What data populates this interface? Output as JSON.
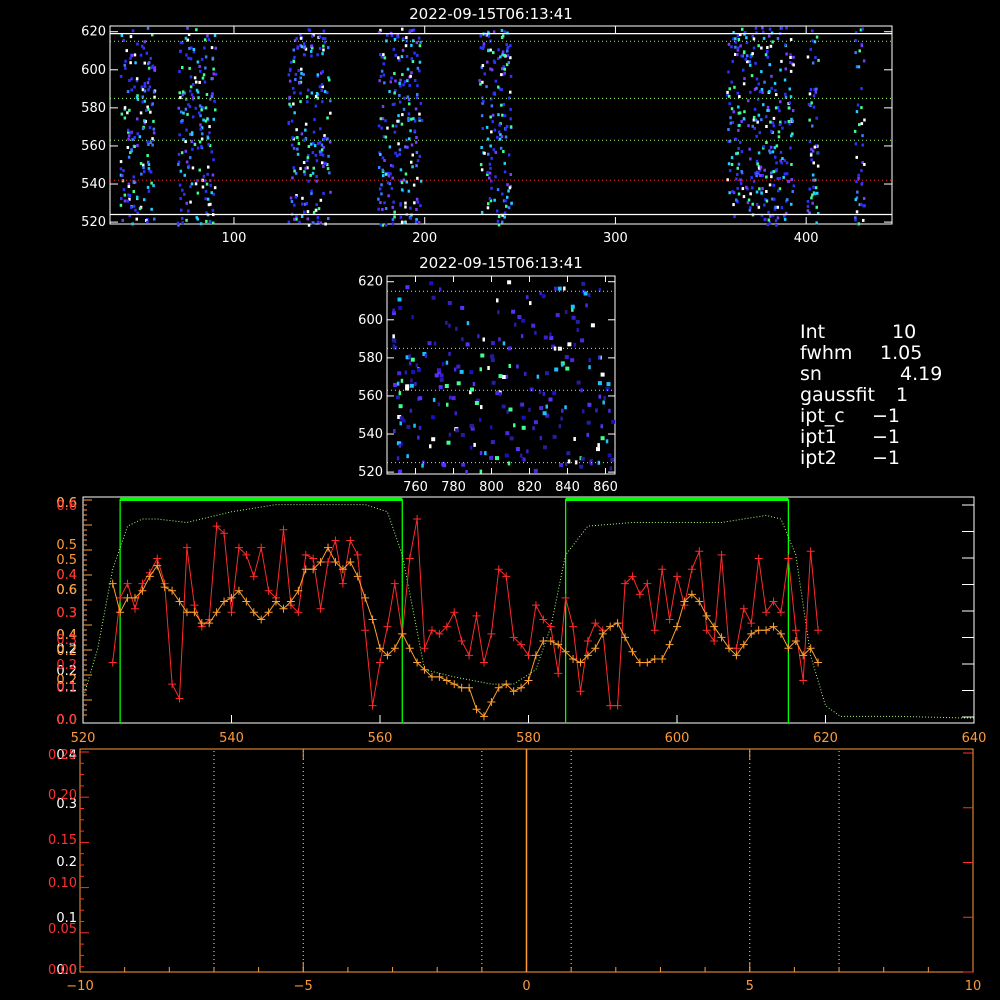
{
  "colors": {
    "background": "#000000",
    "axes": "#ffffff",
    "red_series": "#ff2a2a",
    "orange_series": "#ffa030",
    "green_dotted": "#a0ff70",
    "green_band": "#00ff00",
    "dark_orange_axis": "#ff9a3a",
    "blue_pixels": "#3030ff",
    "cyan_pixels": "#20d0ff"
  },
  "info_panel": [
    {
      "key": "Int",
      "value": "10"
    },
    {
      "key": "fwhm",
      "value": "1.05"
    },
    {
      "key": "sn",
      "value": "4.19"
    },
    {
      "key": "gaussfit",
      "value": "1"
    },
    {
      "key": "ipt_c",
      "value": "−1"
    },
    {
      "key": "ipt1",
      "value": "−1"
    },
    {
      "key": "ipt2",
      "value": "−1"
    }
  ],
  "chart_data": [
    {
      "type": "heatmap",
      "title": "2022-09-15T06:13:41",
      "xlim": [
        35,
        445
      ],
      "ylim": [
        519,
        623
      ],
      "x_ticks": [
        100,
        200,
        300,
        400
      ],
      "y_ticks": [
        520,
        540,
        560,
        580,
        600,
        620
      ],
      "hlines_white": [
        619,
        524
      ],
      "hlines_green_dotted": [
        615,
        585,
        563
      ],
      "hlines_red_dotted": [
        542
      ],
      "pixel_columns": [
        [
          40,
          58
        ],
        [
          70,
          90
        ],
        [
          128,
          150
        ],
        [
          175,
          198
        ],
        [
          228,
          245
        ],
        [
          358,
          393
        ],
        [
          400,
          406
        ],
        [
          425,
          430
        ]
      ]
    },
    {
      "type": "heatmap",
      "title": "2022-09-15T06:13:41",
      "xlim": [
        745,
        865
      ],
      "ylim": [
        519,
        623
      ],
      "x_ticks": [
        760,
        780,
        800,
        820,
        840,
        860
      ],
      "y_ticks": [
        520,
        540,
        560,
        580,
        600,
        620
      ],
      "hlines_green_dotted": [
        615,
        585,
        563,
        525
      ]
    },
    {
      "type": "line",
      "xlim": [
        520,
        640
      ],
      "ylim": [
        0,
        0.61
      ],
      "x_ticks": [
        520,
        540,
        560,
        580,
        600,
        620,
        640
      ],
      "left_tick_labels_white": [
        "0.0",
        "0.1",
        "0.2",
        "0.2",
        "0.4",
        "0.6",
        "0.6"
      ],
      "left_tick_labels_orange": [
        "0.0",
        "0.2",
        "0.2",
        "0.4",
        "0.6",
        "0.3",
        "0.4",
        "0.5",
        "0.5",
        "0.6"
      ],
      "left_tick_labels_red": [
        "0.0",
        "0.1",
        "0.2",
        "0.3",
        "0.3",
        "0.4",
        "0.6"
      ],
      "green_bands": [
        [
          525,
          563
        ],
        [
          585,
          615
        ]
      ],
      "series": [
        {
          "x": [
            524,
            525,
            526,
            527,
            528,
            529,
            530,
            531,
            532,
            533,
            534,
            535,
            536,
            537,
            538,
            539,
            540,
            541,
            542,
            543,
            544,
            545,
            546,
            547,
            548,
            549,
            550,
            551,
            552,
            553,
            554,
            555,
            556,
            557,
            558,
            559,
            560,
            561,
            562,
            563,
            564,
            565,
            566,
            567,
            568,
            569,
            570,
            571,
            572,
            573,
            574,
            575,
            576,
            577,
            578,
            579,
            580,
            581,
            582,
            583,
            584,
            585,
            586,
            587,
            588,
            589,
            590,
            591,
            592,
            593,
            594,
            595,
            596,
            597,
            598,
            599,
            600,
            601,
            602,
            603,
            604,
            605,
            606,
            607,
            608,
            609,
            610,
            611,
            612,
            613,
            614,
            615,
            616,
            617,
            618,
            619
          ],
          "values": [
            0.16,
            0.34,
            0.38,
            0.31,
            0.38,
            0.41,
            0.45,
            0.38,
            0.1,
            0.06,
            0.48,
            0.32,
            0.26,
            0.28,
            0.54,
            0.52,
            0.3,
            0.48,
            0.46,
            0.4,
            0.48,
            0.36,
            0.34,
            0.53,
            0.32,
            0.3,
            0.46,
            0.45,
            0.31,
            0.44,
            0.5,
            0.38,
            0.5,
            0.46,
            0.25,
            0.04,
            0.16,
            0.26,
            0.38,
            0.24,
            0.45,
            0.56,
            0.2,
            0.25,
            0.24,
            0.26,
            0.3,
            0.22,
            0.18,
            0.29,
            0.16,
            0.24,
            0.42,
            0.4,
            0.23,
            0.21,
            0.18,
            0.32,
            0.28,
            0.26,
            0.13,
            0.34,
            0.26,
            0.08,
            0.22,
            0.27,
            0.25,
            0.04,
            0.04,
            0.38,
            0.4,
            0.35,
            0.38,
            0.25,
            0.42,
            0.28,
            0.4,
            0.32,
            0.42,
            0.47,
            0.25,
            0.22,
            0.46,
            0.2,
            0.2,
            0.31,
            0.27,
            0.45,
            0.3,
            0.33,
            0.3,
            0.45,
            0.25,
            0.11,
            0.47,
            0.25
          ]
        },
        {
          "x": [
            524,
            525,
            526,
            527,
            528,
            529,
            530,
            531,
            532,
            533,
            534,
            535,
            536,
            537,
            538,
            539,
            540,
            541,
            542,
            543,
            544,
            545,
            546,
            547,
            548,
            549,
            550,
            551,
            552,
            553,
            554,
            555,
            556,
            557,
            558,
            559,
            560,
            561,
            562,
            563,
            564,
            565,
            566,
            567,
            568,
            569,
            570,
            571,
            572,
            573,
            574,
            575,
            576,
            577,
            578,
            579,
            580,
            581,
            582,
            583,
            584,
            585,
            586,
            587,
            588,
            589,
            590,
            591,
            592,
            593,
            594,
            595,
            596,
            597,
            598,
            599,
            600,
            601,
            602,
            603,
            604,
            605,
            606,
            607,
            608,
            609,
            610,
            611,
            612,
            613,
            614,
            615,
            616,
            617,
            618,
            619
          ],
          "values": [
            0.38,
            0.3,
            0.34,
            0.34,
            0.36,
            0.4,
            0.43,
            0.37,
            0.36,
            0.33,
            0.3,
            0.3,
            0.27,
            0.27,
            0.3,
            0.33,
            0.34,
            0.36,
            0.33,
            0.3,
            0.28,
            0.3,
            0.33,
            0.31,
            0.33,
            0.36,
            0.42,
            0.42,
            0.44,
            0.48,
            0.44,
            0.42,
            0.44,
            0.4,
            0.34,
            0.28,
            0.2,
            0.18,
            0.2,
            0.24,
            0.2,
            0.16,
            0.14,
            0.12,
            0.12,
            0.11,
            0.1,
            0.09,
            0.09,
            0.03,
            0.01,
            0.05,
            0.09,
            0.1,
            0.08,
            0.09,
            0.11,
            0.18,
            0.22,
            0.22,
            0.21,
            0.19,
            0.17,
            0.16,
            0.18,
            0.2,
            0.24,
            0.26,
            0.27,
            0.23,
            0.19,
            0.16,
            0.16,
            0.17,
            0.17,
            0.21,
            0.26,
            0.33,
            0.35,
            0.33,
            0.29,
            0.26,
            0.23,
            0.2,
            0.18,
            0.21,
            0.24,
            0.25,
            0.25,
            0.26,
            0.24,
            0.2,
            0.22,
            0.18,
            0.2,
            0.16
          ]
        },
        {
          "x": [
            520,
            522,
            524,
            526,
            528,
            530,
            534,
            540,
            546,
            552,
            558,
            561,
            563,
            566,
            570,
            575,
            578,
            581,
            583,
            585,
            588,
            594,
            600,
            606,
            612,
            614,
            616,
            618,
            620,
            622,
            624,
            630,
            640
          ],
          "values": [
            0.06,
            0.2,
            0.42,
            0.54,
            0.56,
            0.56,
            0.55,
            0.58,
            0.6,
            0.6,
            0.6,
            0.58,
            0.46,
            0.14,
            0.12,
            0.1,
            0.1,
            0.14,
            0.26,
            0.46,
            0.54,
            0.55,
            0.55,
            0.55,
            0.57,
            0.56,
            0.46,
            0.18,
            0.04,
            0.01,
            0.01,
            0.01,
            0.005
          ]
        }
      ]
    },
    {
      "type": "line",
      "xlim": [
        -10,
        10
      ],
      "x_ticks": [
        -10,
        -5,
        0,
        5,
        10
      ],
      "left_tick_labels_white": [
        "0.0",
        "0.1",
        "0.2",
        "0.3",
        "0.4"
      ],
      "left_tick_labels_red": [
        "0.00",
        "0.05",
        "0.10",
        "0.15",
        "0.20",
        "0.25"
      ],
      "vlines_white_dotted": [
        -7,
        -5,
        -1,
        1,
        5,
        7
      ],
      "vline_orange": 0
    }
  ]
}
